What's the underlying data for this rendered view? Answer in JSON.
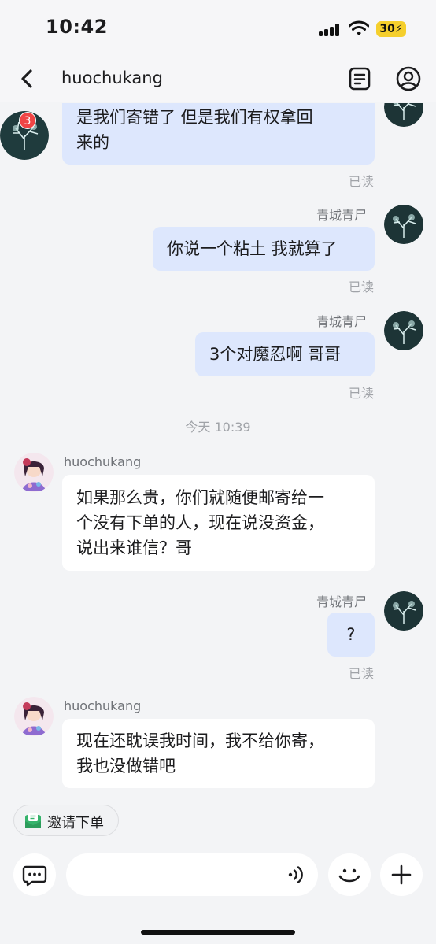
{
  "status_bar": {
    "time": "10:42",
    "battery": "30"
  },
  "header": {
    "title": "huochukang",
    "back_icon": "chevron-left-icon",
    "note_icon": "note-icon",
    "profile_icon": "profile-icon"
  },
  "messages": [
    {
      "side": "left",
      "text_lines": [
        "是我们寄错了 但是我们有权拿回",
        "来的"
      ],
      "unread_badge": "3",
      "read": "已读"
    },
    {
      "side": "right",
      "sender": "青城青尸",
      "text": "你说一个粘土 我就算了",
      "read": "已读"
    },
    {
      "side": "right",
      "sender": "青城青尸",
      "text": "3个对魔忍啊 哥哥",
      "read": "已读"
    },
    {
      "timestamp": "今天 10:39"
    },
    {
      "side": "left",
      "sender": "huochukang",
      "text_lines": [
        "如果那么贵，你们就随便邮寄给一",
        "个没有下单的人，现在说没资金，",
        "说出来谁信？哥"
      ]
    },
    {
      "side": "right",
      "sender": "青城青尸",
      "text": "?",
      "read": "已读"
    },
    {
      "side": "left",
      "sender": "huochukang",
      "text_lines": [
        "现在还耽误我时间，我不给你寄，",
        "我也没做错吧"
      ]
    }
  ],
  "quick_action": {
    "label": "邀请下单",
    "icon": "envelope-icon"
  },
  "composer": {
    "emoji_icon": "emoji-icon",
    "plus_icon": "plus-icon",
    "menu_icon": "chat-menu-icon",
    "voice_icon": "voice-icon"
  },
  "colors": {
    "my_bubble": "#dde7fd",
    "their_bubble": "#ffffff",
    "background": "#f3f4f6",
    "badge": "#f04545",
    "battery": "#f5cf2d"
  }
}
